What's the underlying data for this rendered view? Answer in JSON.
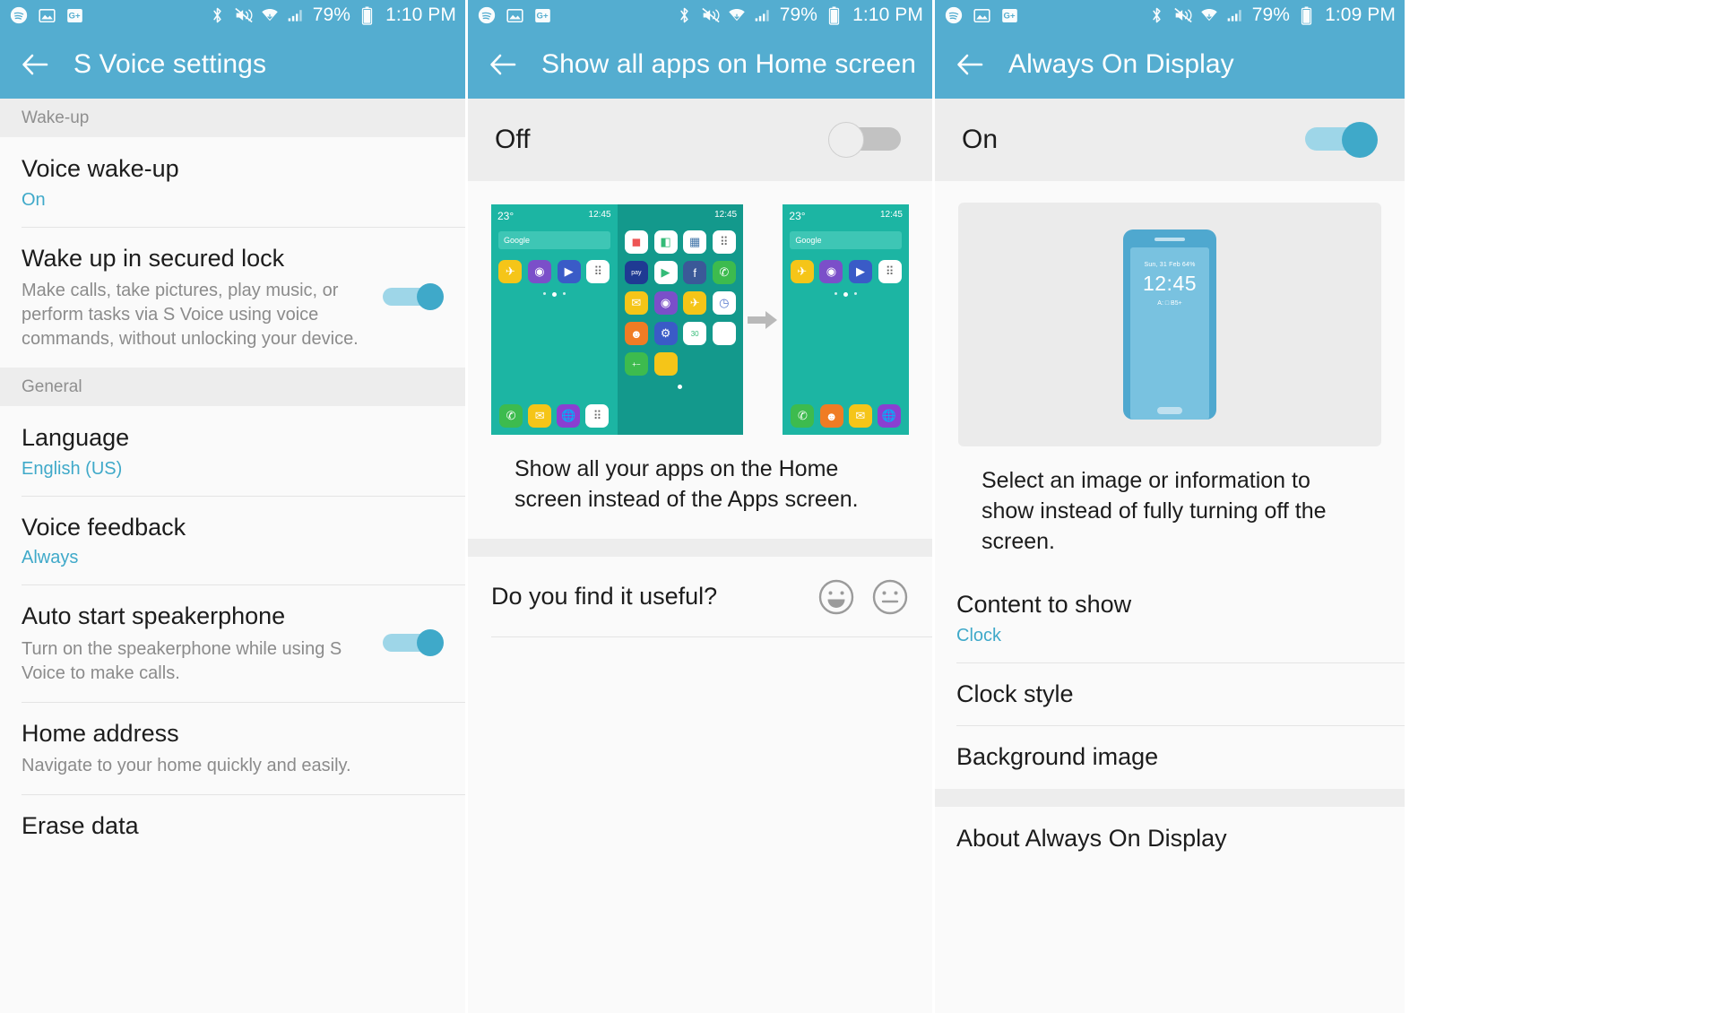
{
  "statusbar": {
    "battery": "79%",
    "time_left": "1:10 PM",
    "time_mid": "1:10 PM",
    "time_right": "1:09 PM",
    "icons": [
      "spotify-icon",
      "gallery-icon",
      "google-plus-icon",
      "bluetooth-icon",
      "mute-vibrate-icon",
      "wifi-icon",
      "signal-icon",
      "battery-icon"
    ]
  },
  "accent_color": "#3FA9C9",
  "appbar_color": "#54ADD0",
  "panel1": {
    "title": "S Voice settings",
    "sections": [
      {
        "header": "Wake-up",
        "items": [
          {
            "title": "Voice wake-up",
            "value": "On",
            "sub": "",
            "toggle": null
          },
          {
            "title": "Wake up in secured lock",
            "value": "",
            "sub": "Make calls, take pictures, play music, or perform tasks via S Voice using voice commands, without unlocking your device.",
            "toggle": "on"
          }
        ]
      },
      {
        "header": "General",
        "items": [
          {
            "title": "Language",
            "value": "English (US)",
            "sub": "",
            "toggle": null
          },
          {
            "title": "Voice feedback",
            "value": "Always",
            "sub": "",
            "toggle": null
          },
          {
            "title": "Auto start speakerphone",
            "value": "",
            "sub": "Turn on the speakerphone while using S Voice to make calls.",
            "toggle": "on"
          },
          {
            "title": "Home address",
            "value": "",
            "sub": "Navigate to your home quickly and easily.",
            "toggle": null
          },
          {
            "title": "Erase data",
            "value": "",
            "sub": "",
            "toggle": null
          }
        ]
      }
    ]
  },
  "panel2": {
    "title": "Show all apps on Home screen",
    "master_label": "Off",
    "master_state": "off",
    "caption": "Show all your apps on the Home screen instead of the Apps screen.",
    "feedback_question": "Do you find it useful?",
    "feedback_icons": [
      "happy-face-icon",
      "neutral-face-icon"
    ],
    "preview": {
      "weather": "23°",
      "clock": "12:45",
      "search_hint": "Google"
    }
  },
  "panel3": {
    "title": "Always On Display",
    "master_label": "On",
    "master_state": "on",
    "caption": "Select an image or information to show instead of fully turning off the screen.",
    "preview": {
      "date": "Sun, 31 Feb  64%",
      "time": "12:45",
      "meta": "A: □  B5+"
    },
    "items": [
      {
        "title": "Content to show",
        "value": "Clock"
      },
      {
        "title": "Clock style",
        "value": ""
      },
      {
        "title": "Background image",
        "value": ""
      },
      {
        "title": "About Always On Display",
        "value": ""
      }
    ]
  }
}
